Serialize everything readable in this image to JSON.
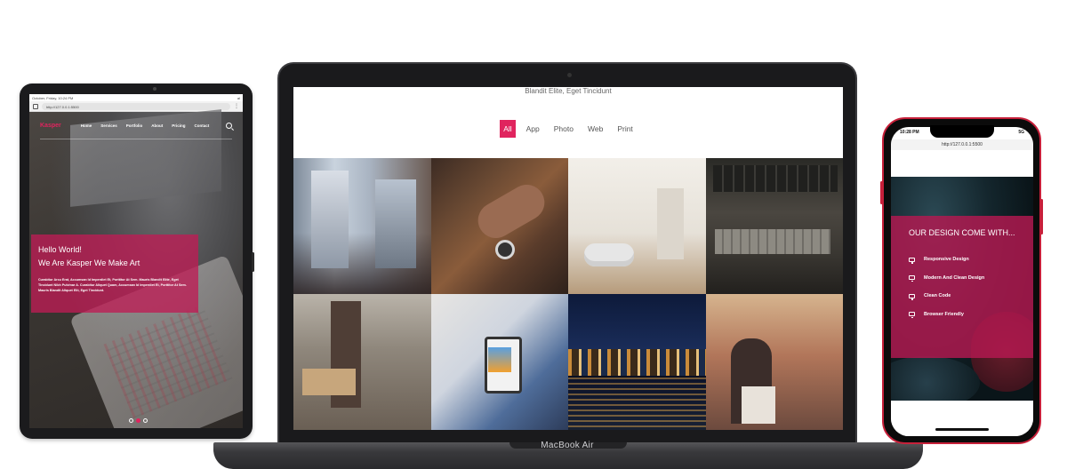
{
  "tablet": {
    "status_left": "October, Friday, 10:24 PM",
    "status_right": "al",
    "url": "http://127.0.0.1:5500",
    "brand": "Kasper",
    "menu": [
      "Home",
      "Services",
      "Portfolio",
      "About",
      "Pricing",
      "Contact"
    ],
    "hero_line1": "Hello World!",
    "hero_line2": "We Are Kasper We Make Art",
    "hero_text": "Curabitur Arcu Erat, Accumsan Id Imperdiet Et, Porttitor At Sem. Mauris Blandit Elite, Eget Tincidunt Nibh Pulvinar A. Curabitur Aliquet Quam, Accumsan Id Imperdiet Et, Porttitor At Sem. Mauris Blandit Aliquet Elit, Eget Tincidunt.",
    "slider_dots": 3,
    "active_dot": 2
  },
  "laptop": {
    "subtitle": "Blandit Elite, Eget Tincidunt",
    "filters": [
      "All",
      "App",
      "Photo",
      "Web",
      "Print"
    ],
    "active_filter": "All",
    "brand": "MacBook Air"
  },
  "phone": {
    "time": "10:28 PM",
    "signal": "5G",
    "url": "http://127.0.0.1:5500",
    "card_title": "OUR DESIGN COME WITH...",
    "features": [
      "Responsive Design",
      "Modern And Clean Design",
      "Clean Code",
      "Browser Friendly"
    ]
  },
  "colors": {
    "accent": "#e0245e",
    "phone_frame": "#c7203a"
  }
}
